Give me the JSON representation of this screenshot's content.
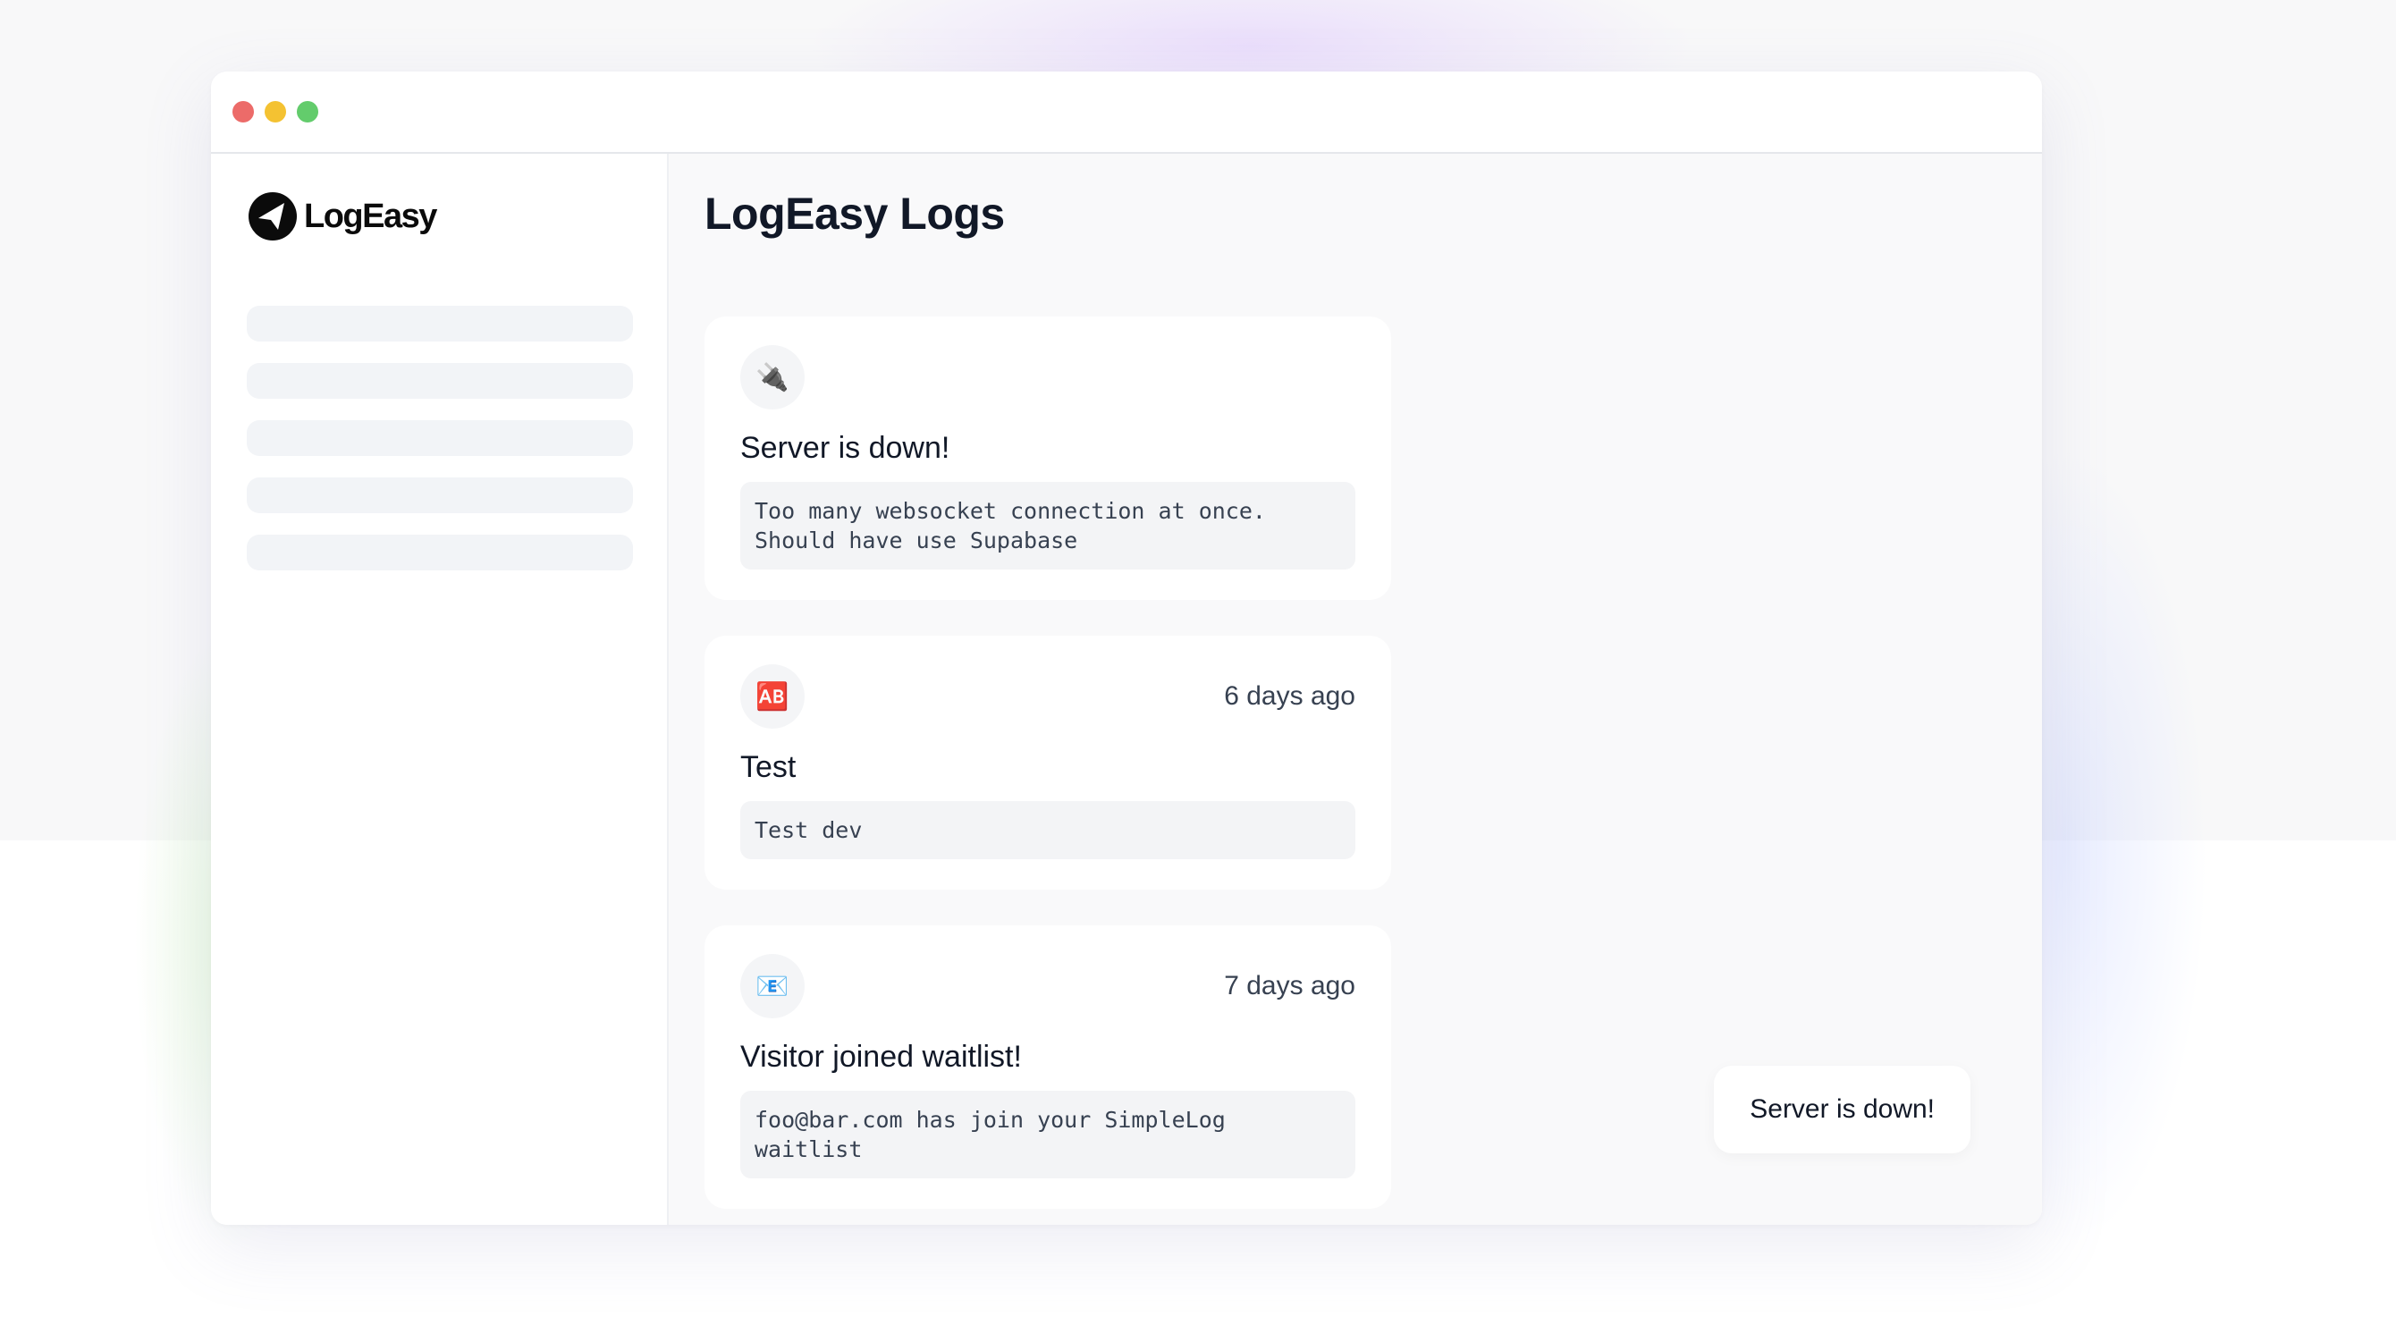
{
  "app": {
    "logo_text": "LogEasy",
    "page_title": "LogEasy Logs"
  },
  "nav": {
    "skeleton_count": 5
  },
  "logs": [
    {
      "icon": "🔌",
      "icon_name": "plug-icon",
      "time": "",
      "title": "Server is down!",
      "message": "Too many websocket connection at once. Should have use Supabase"
    },
    {
      "icon": "🆎",
      "icon_name": "ab-button-icon",
      "time": "6 days ago",
      "title": "Test",
      "message": "Test dev"
    },
    {
      "icon": "📧",
      "icon_name": "email-icon",
      "time": "7 days ago",
      "title": "Visitor joined waitlist!",
      "message": "foo@bar.com has join your SimpleLog waitlist"
    }
  ],
  "toast": {
    "text": "Server is down!"
  },
  "colors": {
    "traffic_red": "#ec6b69",
    "traffic_yellow": "#f4c232",
    "traffic_green": "#63cc6c"
  }
}
